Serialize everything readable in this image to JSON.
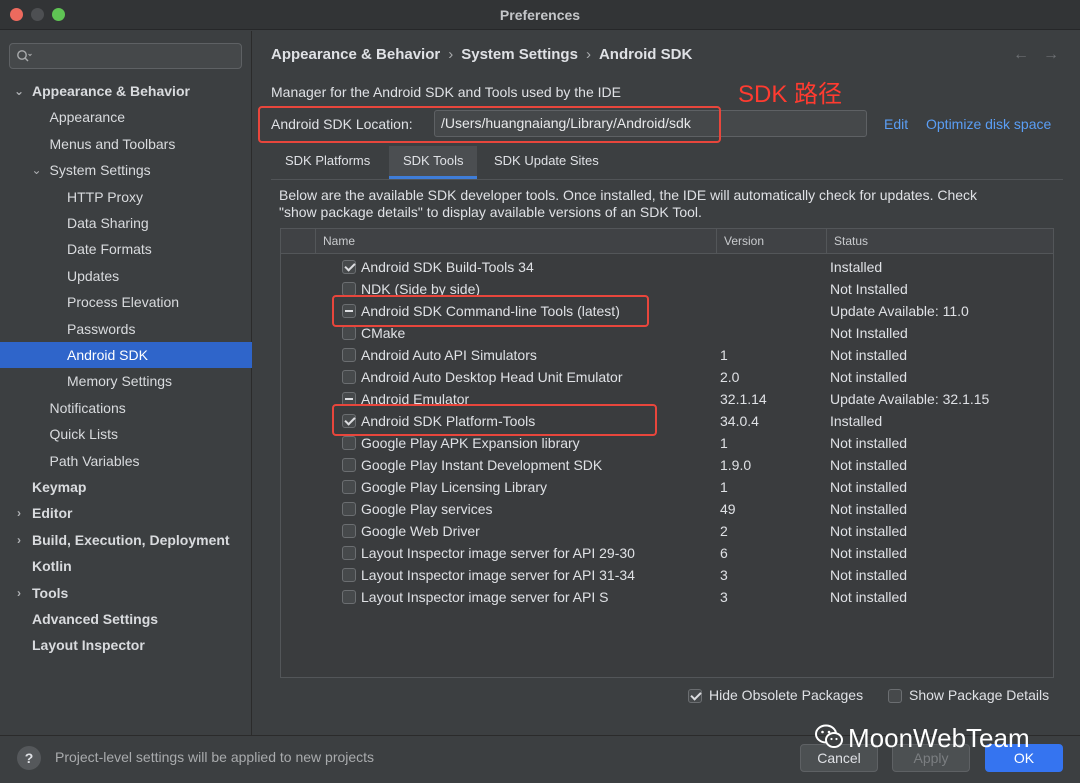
{
  "window": {
    "title": "Preferences"
  },
  "search": {
    "placeholder": ""
  },
  "sidebar": {
    "items": [
      {
        "label": "Appearance & Behavior",
        "bold": true,
        "chevron": "expanded"
      },
      {
        "label": "Appearance"
      },
      {
        "label": "Menus and Toolbars"
      },
      {
        "label": "System Settings",
        "chevron": "expanded"
      },
      {
        "label": "HTTP Proxy"
      },
      {
        "label": "Data Sharing"
      },
      {
        "label": "Date Formats"
      },
      {
        "label": "Updates"
      },
      {
        "label": "Process Elevation"
      },
      {
        "label": "Passwords"
      },
      {
        "label": "Android SDK",
        "selected": true
      },
      {
        "label": "Memory Settings"
      },
      {
        "label": "Notifications"
      },
      {
        "label": "Quick Lists"
      },
      {
        "label": "Path Variables"
      },
      {
        "label": "Keymap",
        "bold": true
      },
      {
        "label": "Editor",
        "bold": true,
        "chevron": "collapsed"
      },
      {
        "label": "Build, Execution, Deployment",
        "bold": true,
        "chevron": "collapsed"
      },
      {
        "label": "Kotlin",
        "bold": true
      },
      {
        "label": "Tools",
        "bold": true,
        "chevron": "collapsed"
      },
      {
        "label": "Advanced Settings",
        "bold": true
      },
      {
        "label": "Layout Inspector",
        "bold": true
      }
    ]
  },
  "breadcrumb": {
    "items": [
      "Appearance & Behavior",
      "System Settings",
      "Android SDK"
    ],
    "separator": "›"
  },
  "main": {
    "description": "Manager for the Android SDK and Tools used by the IDE",
    "annotation": "SDK 路径",
    "location_label": "Android SDK Location:",
    "location_value": "/Users/huangnaiang/Library/Android/sdk",
    "edit_link": "Edit",
    "optimize_link": "Optimize disk space"
  },
  "tabs": [
    {
      "label": "SDK Platforms",
      "active": false
    },
    {
      "label": "SDK Tools",
      "active": true
    },
    {
      "label": "SDK Update Sites",
      "active": false
    }
  ],
  "panel": {
    "description": "Below are the available SDK developer tools. Once installed, the IDE will automatically check for updates. Check \"show package details\" to display available versions of an SDK Tool."
  },
  "table": {
    "columns": [
      "Name",
      "Version",
      "Status"
    ],
    "rows": [
      {
        "state": "checked",
        "name": "Android SDK Build-Tools 34",
        "version": "",
        "status": "Installed"
      },
      {
        "state": "unchecked",
        "name": "NDK (Side by side)",
        "version": "",
        "status": "Not Installed"
      },
      {
        "state": "partial",
        "name": "Android SDK Command-line Tools (latest)",
        "version": "",
        "status": "Update Available: 11.0"
      },
      {
        "state": "unchecked",
        "name": "CMake",
        "version": "",
        "status": "Not Installed"
      },
      {
        "state": "unchecked",
        "name": "Android Auto API Simulators",
        "version": "1",
        "status": "Not installed"
      },
      {
        "state": "unchecked",
        "name": "Android Auto Desktop Head Unit Emulator",
        "version": "2.0",
        "status": "Not installed"
      },
      {
        "state": "partial",
        "name": "Android Emulator",
        "version": "32.1.14",
        "status": "Update Available: 32.1.15"
      },
      {
        "state": "checked",
        "name": "Android SDK Platform-Tools",
        "version": "34.0.4",
        "status": "Installed"
      },
      {
        "state": "unchecked",
        "name": "Google Play APK Expansion library",
        "version": "1",
        "status": "Not installed"
      },
      {
        "state": "unchecked",
        "name": "Google Play Instant Development SDK",
        "version": "1.9.0",
        "status": "Not installed"
      },
      {
        "state": "unchecked",
        "name": "Google Play Licensing Library",
        "version": "1",
        "status": "Not installed"
      },
      {
        "state": "unchecked",
        "name": "Google Play services",
        "version": "49",
        "status": "Not installed"
      },
      {
        "state": "unchecked",
        "name": "Google Web Driver",
        "version": "2",
        "status": "Not installed"
      },
      {
        "state": "unchecked",
        "name": "Layout Inspector image server for API 29-30",
        "version": "6",
        "status": "Not installed"
      },
      {
        "state": "unchecked",
        "name": "Layout Inspector image server for API 31-34",
        "version": "3",
        "status": "Not installed"
      },
      {
        "state": "unchecked",
        "name": "Layout Inspector image server for API S",
        "version": "3",
        "status": "Not installed"
      }
    ]
  },
  "options": {
    "hide_obsolete": {
      "label": "Hide Obsolete Packages",
      "checked": true
    },
    "show_details": {
      "label": "Show Package Details",
      "checked": false
    }
  },
  "footer": {
    "help": "?",
    "hint": "Project-level settings will be applied to new projects",
    "cancel": "Cancel",
    "apply": "Apply",
    "ok": "OK"
  },
  "watermark": {
    "text": "MoonWebTeam"
  },
  "colors": {
    "accent": "#2f65ca",
    "link": "#5a9ef5",
    "annotation_red": "#e8463c",
    "primary_button": "#3574f0"
  }
}
